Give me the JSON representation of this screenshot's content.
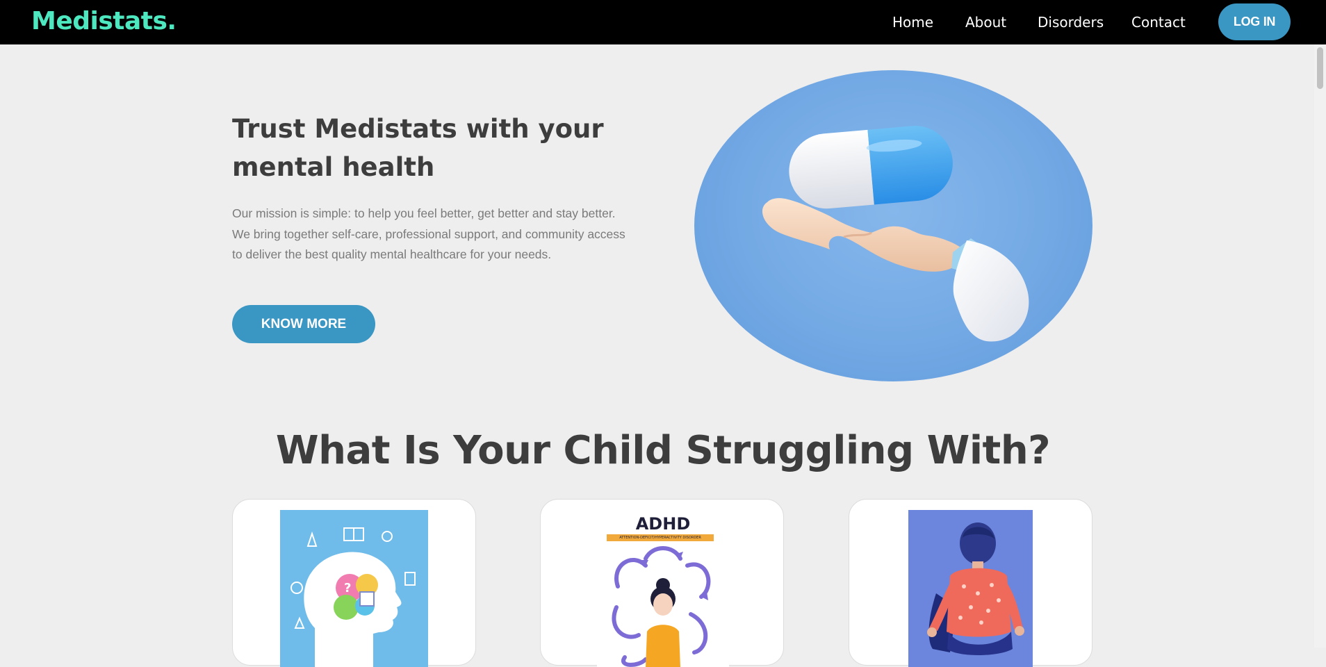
{
  "nav": {
    "brand": "Medistats.",
    "links": [
      "Home",
      "About",
      "Disorders",
      "Contact"
    ],
    "login_label": "LOG IN"
  },
  "hero": {
    "title": "Trust Medistats with your mental health",
    "description": "Our mission is simple: to help you feel better, get better and stay better. We bring together self-care, professional support, and community access to deliver the best quality mental healthcare for your needs.",
    "cta_label": "KNOW MORE",
    "image": "pill-in-hand-illustration"
  },
  "section": {
    "title": "What Is Your Child Struggling With?",
    "cards": [
      {
        "image": "head-silhouette-with-icons-illustration"
      },
      {
        "image": "adhd-illustration",
        "heading": "ADHD",
        "subheading": "ATTENTION-DEFICIT/HYPERACTIVITY DISORDER"
      },
      {
        "image": "child-sitting-back-view-illustration"
      }
    ]
  },
  "colors": {
    "brand": "#4ee8c0",
    "accent": "#3a96c2",
    "navbar": "#000000",
    "background": "#eeeeee",
    "heading": "#3d3d3d"
  }
}
